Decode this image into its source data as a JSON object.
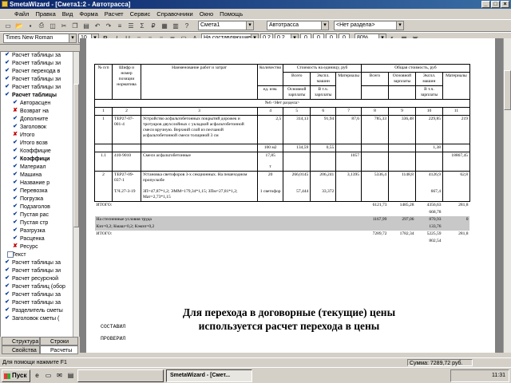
{
  "window": {
    "title": "SmetaWizard - [Смета1:2 - Автотрасса]"
  },
  "menu": [
    "Файл",
    "Правка",
    "Вид",
    "Форма",
    "Расчет",
    "Сервис",
    "Справочники",
    "Окно",
    "Помощь"
  ],
  "toolbar1": {
    "estimate": "Смета1",
    "object": "Автотрасса",
    "section": "<Нет раздела>"
  },
  "toolbar2": {
    "font": "Times New Roman",
    "size": "10",
    "mode": "На составляющие",
    "v1": "0,2",
    "v2": "0,2",
    "z1": "0",
    "z2": "0",
    "z3": "0",
    "z4": "0",
    "zoom": "80%"
  },
  "sidebar": {
    "items": [
      {
        "label": "Расчет таблицы за",
        "icon": "check"
      },
      {
        "label": "Расчет таблицы зи",
        "icon": "check"
      },
      {
        "label": "Расчет перехода в",
        "icon": "check"
      },
      {
        "label": "Расчет таблицы зи",
        "icon": "check"
      },
      {
        "label": "Расчет таблицы зи",
        "icon": "check"
      },
      {
        "label": "Расчет таблицы",
        "icon": "check",
        "bold": true
      },
      {
        "label": "Авторасцен",
        "icon": "check"
      },
      {
        "label": "Возврат на",
        "icon": "cross"
      },
      {
        "label": "Дополните",
        "icon": "check"
      },
      {
        "label": "Заголовок",
        "icon": "check"
      },
      {
        "label": "Итого",
        "icon": "cross"
      },
      {
        "label": "Итого возв",
        "icon": "check"
      },
      {
        "label": "Коэффицие",
        "icon": "check"
      },
      {
        "label": "Коэффици",
        "icon": "check",
        "bold": true
      },
      {
        "label": "Материал",
        "icon": "check"
      },
      {
        "label": "Машина",
        "icon": "check"
      },
      {
        "label": "Название р",
        "icon": "check"
      },
      {
        "label": "Перевозка",
        "icon": "check"
      },
      {
        "label": "Погрузка",
        "icon": "check"
      },
      {
        "label": "Подзаголов",
        "icon": "check"
      },
      {
        "label": "Пустая рас",
        "icon": "check"
      },
      {
        "label": "Пустая стр",
        "icon": "check"
      },
      {
        "label": "Разгрузка",
        "icon": "check"
      },
      {
        "label": "Расценка",
        "icon": "check"
      },
      {
        "label": "Ресурс",
        "icon": "cross"
      },
      {
        "label": "Текст",
        "icon": "page"
      },
      {
        "label": "Расчет таблицы за",
        "icon": "check"
      },
      {
        "label": "Расчет таблицы зи",
        "icon": "check"
      },
      {
        "label": "Расчет ресурсной",
        "icon": "check"
      },
      {
        "label": "Расчет таблиц (обор",
        "icon": "check"
      },
      {
        "label": "Расчет таблицы за",
        "icon": "check"
      },
      {
        "label": "Расчет таблицы за",
        "icon": "check"
      },
      {
        "label": "Разделитель сметы",
        "icon": "check"
      },
      {
        "label": "Заголовок сметы (",
        "icon": "check"
      }
    ],
    "tabs": [
      "Структура",
      "Строки",
      "Свойства",
      "Расчеты"
    ]
  },
  "table": {
    "h_no": "№ п/п",
    "h_code": "Шифр и номер позиции норматива",
    "h_name": "Наименование работ и затрат",
    "h_qty": "Количество",
    "h_unit": "ед. изм.",
    "h_unitcost": "Стоимость на единицу, руб",
    "h_total": "Общая стоимость, руб",
    "h_all": "Всего",
    "h_mach": "Экспл. машин",
    "h_mat": "Материалы",
    "h_basic": "Основной зарплаты",
    "h_incl": "В т.ч. зарплаты",
    "h_all2": "Всего",
    "h_basic2": "Основной зарплаты",
    "h_mach2": "Экспл. машин",
    "h_mat2": "Материалы",
    "h_incl2": "В т.ч. зарплаты",
    "section": "№6 <Нет раздела>",
    "nums": [
      "1",
      "2",
      "3",
      "4",
      "5",
      "6",
      "7",
      "8",
      "9",
      "10",
      "11"
    ],
    "r1": {
      "no": "1",
      "code": "ТЕР27-07-001-4",
      "name": "Устройство асфальтобетонных покрытий дорожек и тротуаров двухслойных с укладкой асфальтобетонной смеси вручную. Верхний слой из песчаной асфальтобетонной смеси толщиной 3 см",
      "qty": "2,5",
      "all": "314,13",
      "mach": "91,94",
      "mat": "87,6",
      "tall": "785,33",
      "tbasic": "336,48",
      "tmach": "229,85",
      "tmat": "219",
      "unit": "100 м2",
      "basic": "134,59",
      "incl": "0,55",
      "tincl": "1,38"
    },
    "r2": {
      "no": "1.1",
      "code": "410-9010",
      "name": "Смеси асфальтобетонные",
      "qty": "17,85",
      "unit": "т",
      "mat": "1057",
      "tmat": "18867,45"
    },
    "r3": {
      "no": "2",
      "code": "ТЕР27-09-037-1",
      "name": "Установка светофоров 3-х секционных. На пешеходном пропускобе",
      "qty": "20",
      "all": "266,0145",
      "mach": "206,241",
      "mat": "3,1395",
      "tall": "5336,4",
      "tbasic": "1148,8",
      "tmach": "4126,9",
      "tmat": "62,8",
      "code2": "Т.Ч.27-3-19",
      "name2": "ЗП=47,87*1,2; ЭММ=179,34*1,15; ЗПм=27,81*1,2; Мат=2,73*1,15",
      "unit": "1 светофор",
      "basic": "57,444",
      "incl": "33,372",
      "tincl": "667,4"
    }
  },
  "totals": {
    "itogo": "ИТОГО:",
    "i1": "6121,73",
    "i2": "1485,28",
    "i3": "4356,63",
    "i4": "281,8",
    "i5": "668,78",
    "cond": "На стесненные условия труда",
    "c1": "1167,99",
    "c2": "297,06",
    "c3": "870,93",
    "c4": "0",
    "c5": "133,76",
    "koef": "Кзп=0,2; Кмаш=0,2; Кэмзп=0,2",
    "itogo2": "ИТОГО:",
    "j1": "7289,72",
    "j2": "1782,34",
    "j3": "5225,59",
    "j4": "281,8",
    "j5": "802,54"
  },
  "overlay": {
    "line1": "Для перехода в договорные (текущие) цены",
    "line2": "используется расчет перехода в цены"
  },
  "sign": {
    "made": "СОСТАВИЛ",
    "checked": "ПРОВЕРИЛ"
  },
  "status": {
    "help": "Для помощи нажмите F1",
    "sum": "Сумма: 7289,72 руб."
  },
  "taskbar": {
    "start": "Пуск",
    "task1": "SmetaWizard - [Смет...",
    "task2": "",
    "time": "11:31"
  }
}
